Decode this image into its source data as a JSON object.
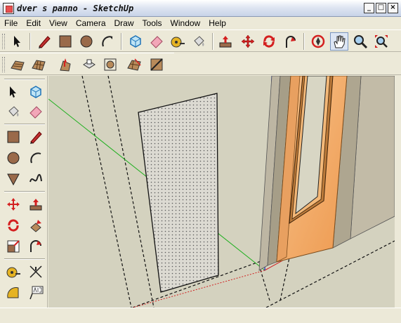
{
  "window": {
    "title": "dver s panno - SketchUp",
    "controls": {
      "minimize": "_",
      "maximize": "□",
      "close": "×"
    }
  },
  "menubar": {
    "items": [
      "File",
      "Edit",
      "View",
      "Camera",
      "Draw",
      "Tools",
      "Window",
      "Help"
    ]
  },
  "toolbar_main": {
    "tools": [
      "select",
      "line",
      "rectangle",
      "circle",
      "arc",
      "make-component",
      "eraser",
      "tape-measure",
      "paint-bucket",
      "push-pull",
      "move",
      "rotate",
      "follow-me",
      "orbit",
      "pan",
      "zoom",
      "zoom-extents"
    ]
  },
  "toolbar_sandbox": {
    "tools": [
      "from-contours",
      "from-scratch",
      "smoove",
      "stamp",
      "drape",
      "add-detail",
      "flip-edge"
    ]
  },
  "left_toolbar": {
    "tools": [
      "select",
      "make-component",
      "paint-bucket",
      "eraser",
      "rectangle",
      "line",
      "circle",
      "arc",
      "polygon",
      "freehand",
      "move",
      "push-pull",
      "rotate",
      "follow-me",
      "scale",
      "offset",
      "tape-measure",
      "dimension",
      "protractor",
      "text"
    ]
  },
  "colors": {
    "accent": "#7a96c2",
    "viewport_bg": "#d4d2bf",
    "door_wood": "#f0a55c",
    "axis_red": "#d02020",
    "axis_green": "#20b020",
    "axis_blue": "#2020c0"
  }
}
